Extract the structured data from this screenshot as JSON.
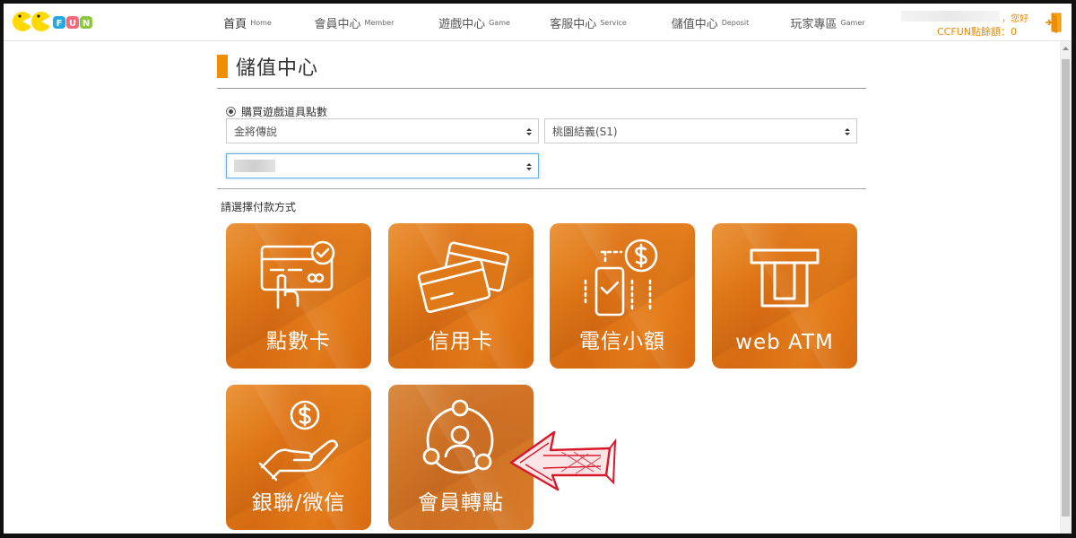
{
  "header": {
    "logo_text": "CCFUN",
    "nav": [
      {
        "zh": "首頁",
        "en": "Home",
        "active": true
      },
      {
        "zh": "會員中心",
        "en": "Member"
      },
      {
        "zh": "遊戲中心",
        "en": "Game"
      },
      {
        "zh": "客服中心",
        "en": "Service"
      },
      {
        "zh": "儲值中心",
        "en": "Deposit"
      },
      {
        "zh": "玩家專區",
        "en": "Gamer"
      }
    ],
    "greeting": "，您好",
    "points": "CCFUN點餘額：0"
  },
  "main": {
    "title": "儲值中心",
    "radio_label": "購買遊戲道具點數",
    "game_select": "金將傳說",
    "server_select": "桃園結義(S1)",
    "payment_label": "請選擇付款方式",
    "methods": [
      {
        "label": "點數卡",
        "icon": "point-card-icon"
      },
      {
        "label": "信用卡",
        "icon": "credit-card-icon"
      },
      {
        "label": "電信小額",
        "icon": "telecom-payment-icon"
      },
      {
        "label": "web ATM",
        "icon": "atm-icon"
      },
      {
        "label": "銀聯/微信",
        "icon": "unionpay-wechat-icon"
      },
      {
        "label": "會員轉點",
        "icon": "member-transfer-icon"
      }
    ]
  },
  "colors": {
    "accent": "#f28f00",
    "tile": "#e07a18",
    "annotation": "#d9182b"
  }
}
